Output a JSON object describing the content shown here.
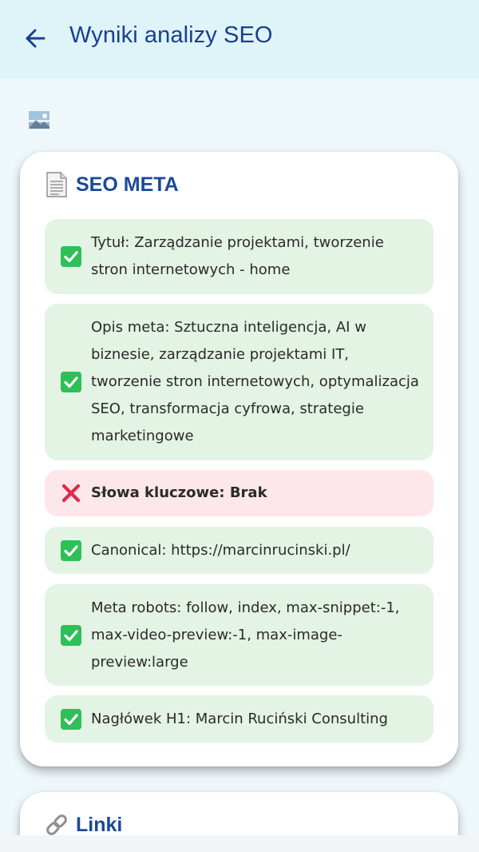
{
  "appbar": {
    "title": "Wyniki analizy SEO",
    "back_icon": "arrow-left-icon",
    "color": "#1a3f8f"
  },
  "sections": {
    "meta": {
      "title": "SEO META",
      "icon": "page-document-icon",
      "items": [
        {
          "status": "ok",
          "icon": "check-mark-icon",
          "text": "Tytuł: Zarządzanie projektami, tworzenie stron internetowych - home"
        },
        {
          "status": "ok",
          "icon": "check-mark-icon",
          "text": "Opis meta: Sztuczna inteligencja, AI w biznesie, zarządzanie projektami IT, tworzenie stron internetowych, optymalizacja SEO, transformacja cyfrowa, strategie marketingowe"
        },
        {
          "status": "bad",
          "icon": "cross-mark-icon",
          "text": "Słowa kluczowe: Brak"
        },
        {
          "status": "ok",
          "icon": "check-mark-icon",
          "text": "Canonical: https://marcinrucinski.pl/"
        },
        {
          "status": "ok",
          "icon": "check-mark-icon",
          "text": "Meta robots: follow, index, max-snippet:-1, max-video-preview:-1, max-image-preview:large"
        },
        {
          "status": "ok",
          "icon": "check-mark-icon",
          "text": "Nagłówek H1: Marcin Ruciński Consulting"
        }
      ]
    },
    "links": {
      "title": "Linki",
      "icon": "link-icon"
    }
  },
  "colors": {
    "ok_bg": "#e3f3e4",
    "bad_bg": "#fde7ea",
    "check_green": "#2fbf58",
    "cross_red": "#e0284a",
    "title_blue": "#1a4a9a"
  }
}
